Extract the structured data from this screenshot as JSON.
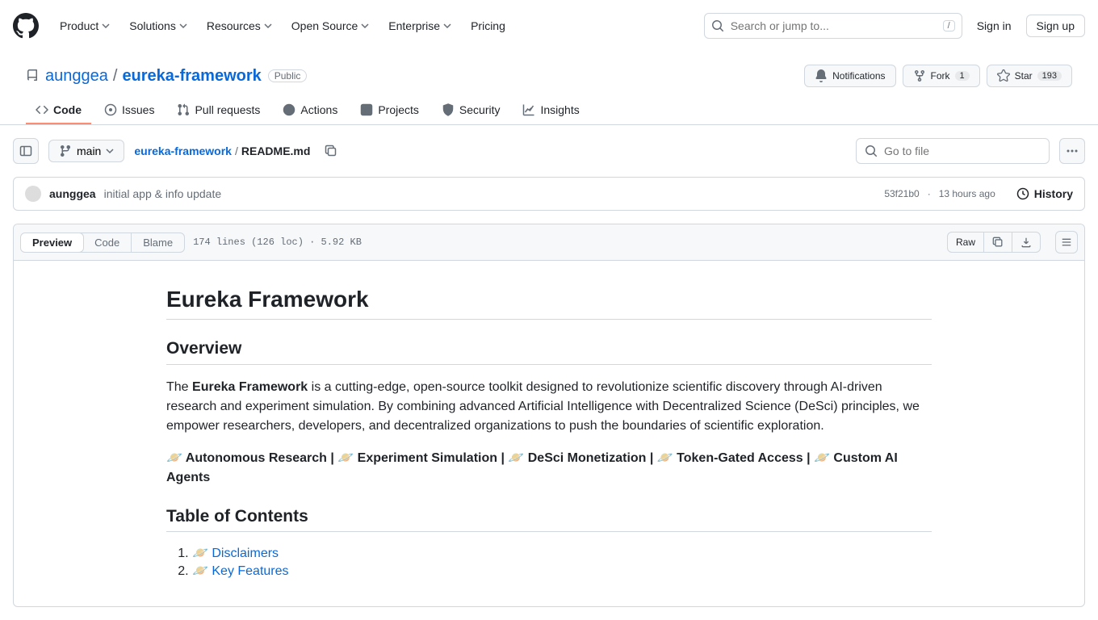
{
  "header": {
    "nav": [
      "Product",
      "Solutions",
      "Resources",
      "Open Source",
      "Enterprise",
      "Pricing"
    ],
    "search_placeholder": "Search or jump to...",
    "search_kbd": "/",
    "signin": "Sign in",
    "signup": "Sign up"
  },
  "repo": {
    "owner": "aunggea",
    "name": "eureka-framework",
    "visibility": "Public",
    "actions": {
      "notifications": "Notifications",
      "fork": "Fork",
      "fork_count": "1",
      "star": "Star",
      "star_count": "193"
    },
    "tabs": [
      "Code",
      "Issues",
      "Pull requests",
      "Actions",
      "Projects",
      "Security",
      "Insights"
    ]
  },
  "file_nav": {
    "branch": "main",
    "breadcrumb_repo": "eureka-framework",
    "breadcrumb_file": "README.md",
    "gotofile_placeholder": "Go to file"
  },
  "commit": {
    "author": "aunggea",
    "message": "initial app & info update",
    "sha": "53f21b0",
    "sep": "·",
    "time": "13 hours ago",
    "history": "History"
  },
  "file_toolbar": {
    "tabs": [
      "Preview",
      "Code",
      "Blame"
    ],
    "meta": "174 lines (126 loc) · 5.92 KB",
    "raw": "Raw"
  },
  "readme": {
    "h1": "Eureka Framework",
    "overview_h": "Overview",
    "p1_pre": "The ",
    "p1_bold": "Eureka Framework",
    "p1_post": " is a cutting-edge, open-source toolkit designed to revolutionize scientific discovery through AI-driven research and experiment simulation. By combining advanced Artificial Intelligence with Decentralized Science (DeSci) principles, we empower researchers, developers, and decentralized organizations to push the boundaries of scientific exploration.",
    "features_line": "🪐 Autonomous Research | 🪐 Experiment Simulation | 🪐 DeSci Monetization | 🪐 Token-Gated Access | 🪐 Custom AI Agents",
    "toc_h": "Table of Contents",
    "toc": [
      "🪐 Disclaimers",
      "🪐 Key Features"
    ]
  }
}
